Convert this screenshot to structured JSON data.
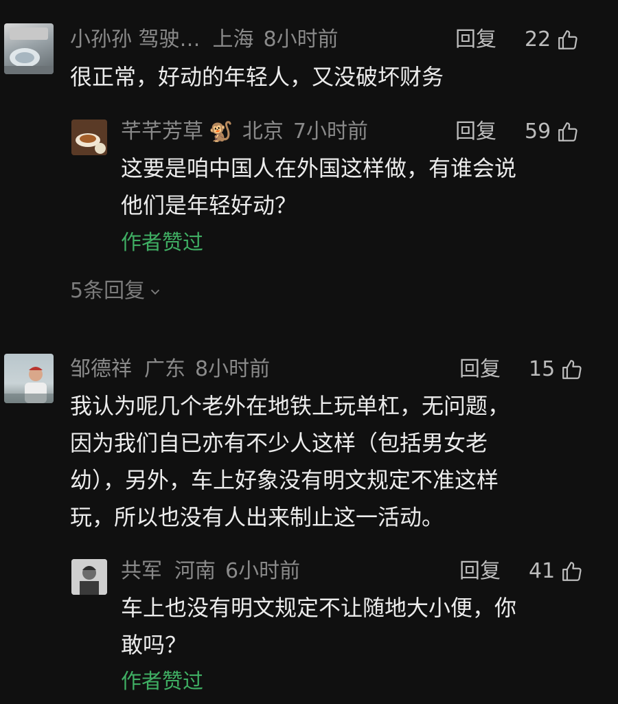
{
  "comments": [
    {
      "user": "小孙孙 驾驶…",
      "location": "上海",
      "time": "8小时前",
      "reply_label": "回复",
      "likes": "22",
      "text_lines": [
        "很正常，好动的年轻人，又没破坏财务"
      ],
      "replies": [
        {
          "user": "芊芊芳草",
          "user_emoji": "🐒",
          "location": "北京",
          "time": "7小时前",
          "reply_label": "回复",
          "likes": "59",
          "text_lines": [
            "这要是咱中国人在外国这样做，有谁会说",
            "他们是年轻好动？"
          ],
          "author_liked": "作者赞过"
        }
      ],
      "more_replies": "5条回复"
    },
    {
      "user": "邹德祥",
      "location": "广东",
      "time": "8小时前",
      "reply_label": "回复",
      "likes": "15",
      "text_lines": [
        "我认为呢几个老外在地铁上玩单杠，无问题，",
        "因为我们自已亦有不少人这样（包括男女老",
        "幼），另外，车上好象没有明文规定不准这样",
        "玩，所以也没有人出来制止这一活动。"
      ],
      "replies": [
        {
          "user": "共军",
          "location": "河南",
          "time": "6小时前",
          "reply_label": "回复",
          "likes": "41",
          "text_lines": [
            "车上也没有明文规定不让随地大小便，你",
            "敢吗？"
          ],
          "author_liked": "作者赞过"
        }
      ]
    }
  ]
}
